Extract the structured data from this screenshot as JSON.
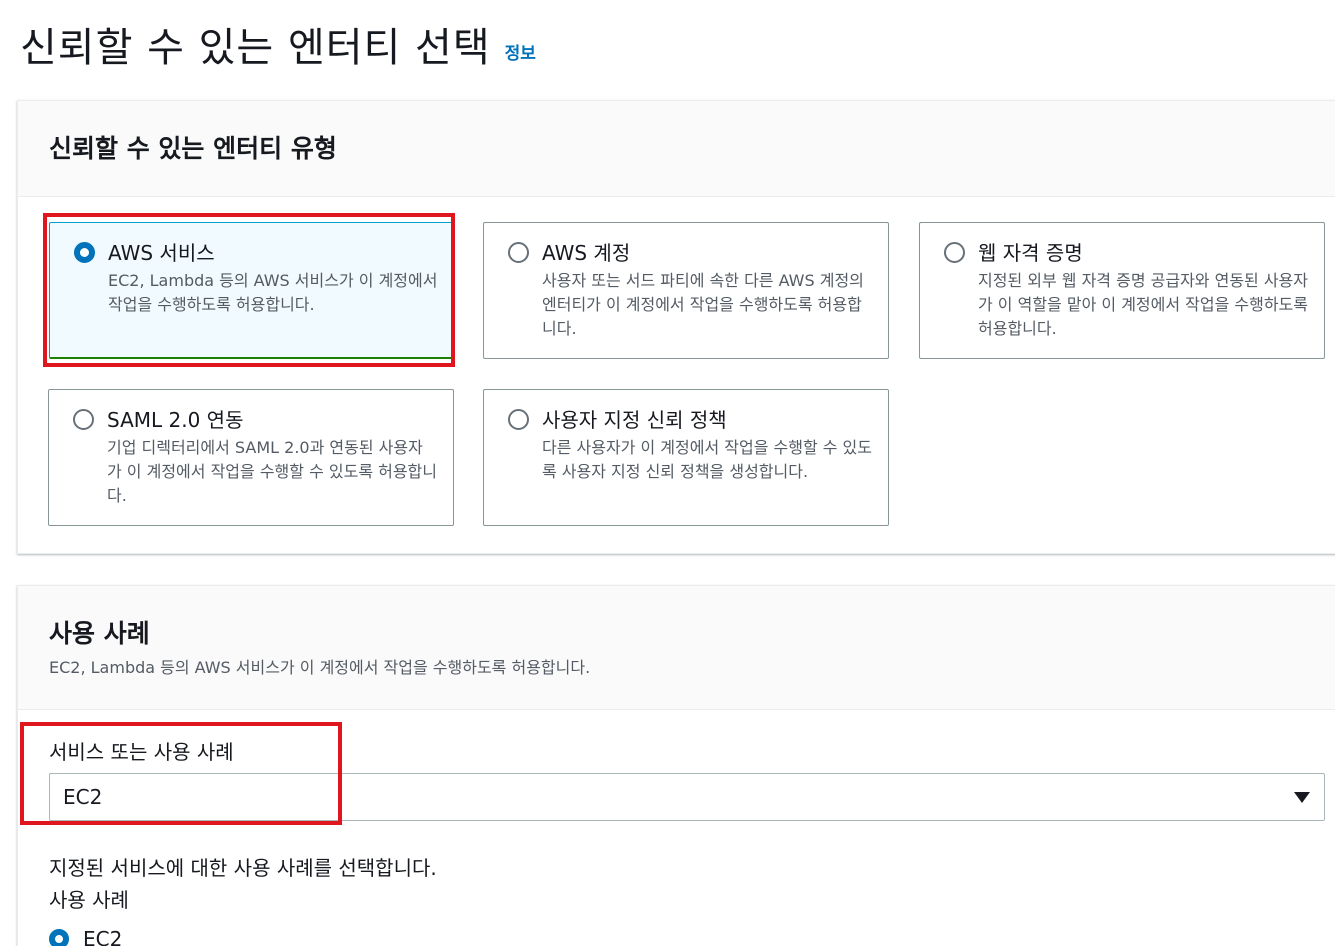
{
  "header": {
    "title": "신뢰할 수 있는 엔터티 선택",
    "info_link": "정보"
  },
  "entity_type": {
    "title": "신뢰할 수 있는 엔터티 유형",
    "options": [
      {
        "label": "AWS 서비스",
        "description": "EC2, Lambda 등의 AWS 서비스가 이 계정에서 작업을 수행하도록 허용합니다.",
        "selected": true
      },
      {
        "label": "AWS 계정",
        "description": "사용자 또는 서드 파티에 속한 다른 AWS 계정의 엔터티가 이 계정에서 작업을 수행하도록 허용합니다.",
        "selected": false
      },
      {
        "label": "웹 자격 증명",
        "description": "지정된 외부 웹 자격 증명 공급자와 연동된 사용자가 이 역할을 맡아 이 계정에서 작업을 수행하도록 허용합니다.",
        "selected": false
      },
      {
        "label": "SAML 2.0 연동",
        "description": "기업 디렉터리에서 SAML 2.0과 연동된 사용자가 이 계정에서 작업을 수행할 수 있도록 허용합니다.",
        "selected": false
      },
      {
        "label": "사용자 지정 신뢰 정책",
        "description": "다른 사용자가 이 계정에서 작업을 수행할 수 있도록 사용자 지정 신뢰 정책을 생성합니다.",
        "selected": false
      }
    ]
  },
  "use_case": {
    "title": "사용 사례",
    "description": "EC2, Lambda 등의 AWS 서비스가 이 계정에서 작업을 수행하도록 허용합니다.",
    "field_label": "서비스 또는 사용 사례",
    "select_value": "EC2",
    "help_text": "지정된 서비스에 대한 사용 사례를 선택합니다.",
    "use_case_label": "사용 사례",
    "selected_option": "EC2"
  },
  "colors": {
    "accent": "#0073bb",
    "highlight": "#e0161f",
    "selected_tile_bg": "#f1faff"
  }
}
